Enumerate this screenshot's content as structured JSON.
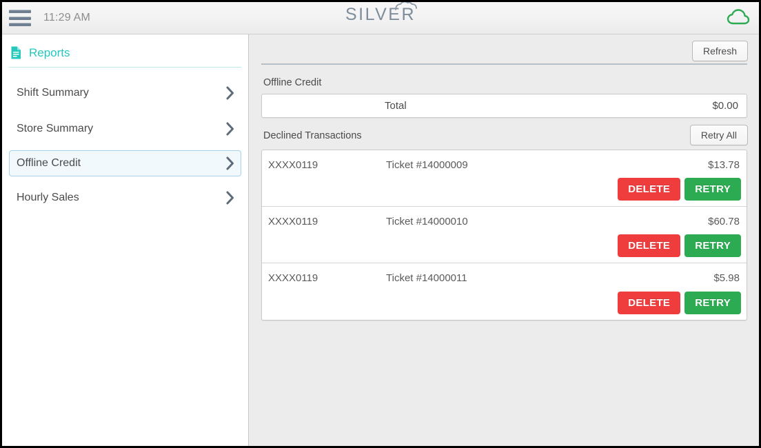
{
  "topbar": {
    "menu_icon": "hamburger-menu-icon",
    "clock": "11:29 AM",
    "brand": "SILVER",
    "brand_cloud_icon": "cloud-icon",
    "status_icon": "cloud-connected-icon"
  },
  "sidebar": {
    "header": {
      "icon": "document-report-icon",
      "title": "Reports"
    },
    "items": [
      {
        "label": "Shift Summary",
        "selected": false,
        "chevron": "chevron-right-icon"
      },
      {
        "label": "Store Summary",
        "selected": false,
        "chevron": "chevron-right-icon"
      },
      {
        "label": "Offline Credit",
        "selected": true,
        "chevron": "chevron-right-icon"
      },
      {
        "label": "Hourly Sales",
        "selected": false,
        "chevron": "chevron-right-icon"
      }
    ]
  },
  "content": {
    "refresh_label": "Refresh",
    "offline_credit_label": "Offline Credit",
    "total_label": "Total",
    "total_value": "$0.00",
    "declined_label": "Declined Transactions",
    "retry_all_label": "Retry All",
    "delete_label": "DELETE",
    "retry_label": "RETRY",
    "transactions": [
      {
        "card": "XXXX0119",
        "ticket": "Ticket #14000009",
        "amount": "$13.78"
      },
      {
        "card": "XXXX0119",
        "ticket": "Ticket #14000010",
        "amount": "$60.78"
      },
      {
        "card": "XXXX0119",
        "ticket": "Ticket #14000011",
        "amount": "$5.98"
      }
    ]
  },
  "colors": {
    "accent_teal": "#25c8bd",
    "selected_border": "#a5d2e8",
    "selected_bg": "#f2f9fd",
    "delete_red": "#ef3d3d",
    "retry_green": "#2cab52",
    "cloud_green": "#2cab52",
    "brand_gray": "#7e8c9c"
  }
}
